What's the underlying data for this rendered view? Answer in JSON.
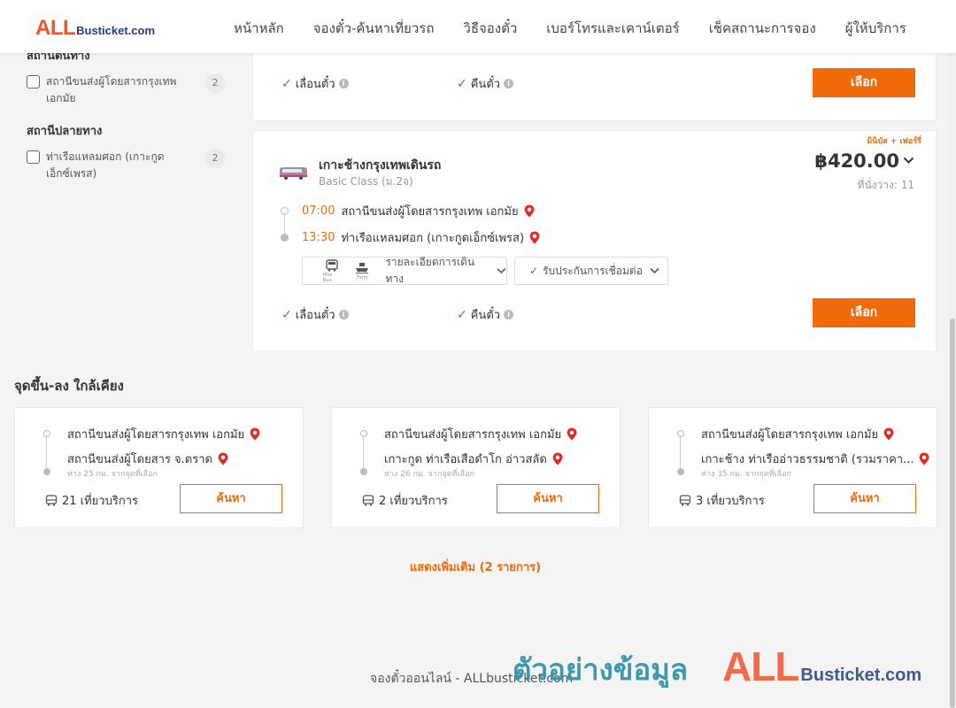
{
  "logo": {
    "all": "ALL",
    "bus": "Busticket.com"
  },
  "nav": [
    "หน้าหลัก",
    "จองตั๋ว-ค้นหาเที่ยวรถ",
    "วิธีจองตั๋ว",
    "เบอร์โทรและเคาน์เตอร์",
    "เช็คสถานะการจอง",
    "ผู้ให้บริการ"
  ],
  "sidebar": {
    "origin_heading": "สถานีต้นทาง",
    "origin_items": [
      {
        "label": "สถานีขนส่งผู้โดยสารกรุงเทพ เอกมัย",
        "count": "2"
      }
    ],
    "dest_heading": "สถานีปลายทาง",
    "dest_items": [
      {
        "label": "ท่าเรือแหลมศอก (เกาะกูด เอ็กซ์เพรส)",
        "count": "2"
      }
    ]
  },
  "card1": {
    "feature1": "เลื่อนตั๋ว",
    "feature2": "คืนตั๋ว",
    "select_label": "เลือก"
  },
  "card2": {
    "tag": "มินิบัส + เฟอร์รี่",
    "operator": "เกาะช้างกรุงเทพเดินรถ",
    "class": "Basic Class (ม.2จ)",
    "price": "฿420.00",
    "seats": "ที่นั่งว่าง: 11",
    "depart_time": "07:00",
    "depart_stop": "สถานีขนส่งผู้โดยสารกรุงเทพ เอกมัย",
    "arrive_time": "13:30",
    "arrive_stop": "ท่าเรือแหลมศอก (เกาะกูดเอ็กซ์เพรส)",
    "vehicle1": "Mini Bus",
    "vehicle2": "Ferry",
    "details_label": "รายละเอียดการเดินทาง",
    "insurance_label": "รับประกันการเชื่อมต่อ",
    "feature1": "เลื่อนตั๋ว",
    "feature2": "คืนตั๋ว",
    "select_label": "เลือก"
  },
  "nearby": {
    "title": "จุดขึ้น-ลง ใกล้เคียง",
    "cards": [
      {
        "from": "สถานีขนส่งผู้โดยสารกรุงเทพ เอกมัย",
        "to": "สถานีขนส่งผู้โดยสาร จ.ตราด",
        "dist": "ห่าง 25 กม. จากจุดที่เลือก",
        "trips": "21 เที่ยวบริการ",
        "search": "ค้นหา"
      },
      {
        "from": "สถานีขนส่งผู้โดยสารกรุงเทพ เอกมัย",
        "to": "เกาะกูด ท่าเรือเสือดำโก อ่าวสลัด",
        "dist": "ห่าง 26 กม. จากจุดที่เลือก",
        "trips": "2 เที่ยวบริการ",
        "search": "ค้นหา"
      },
      {
        "from": "สถานีขนส่งผู้โดยสารกรุงเทพ เอกมัย",
        "to": "เกาะช้าง ท่าเรืออ่าวธรรมชาติ (รวมราคา...",
        "dist": "ห่าง 35 กม. จากจุดที่เลือก",
        "trips": "3 เที่ยวบริการ",
        "search": "ค้นหา"
      }
    ]
  },
  "show_more": "แสดงเพิ่มเติม (2 รายการ)",
  "footer": "จองตั๋วออนไลน์ - ALLbusticket.com",
  "watermark": {
    "text": "ตัวอย่างข้อมูล",
    "all": "ALL",
    "bus": "Busticket.com"
  },
  "colors": {
    "accent": "#f06a0a",
    "logo_red": "#f0542d",
    "logo_navy": "#233e7a",
    "check_green": "#2a9d3c",
    "pin_red": "#e02b2b"
  }
}
